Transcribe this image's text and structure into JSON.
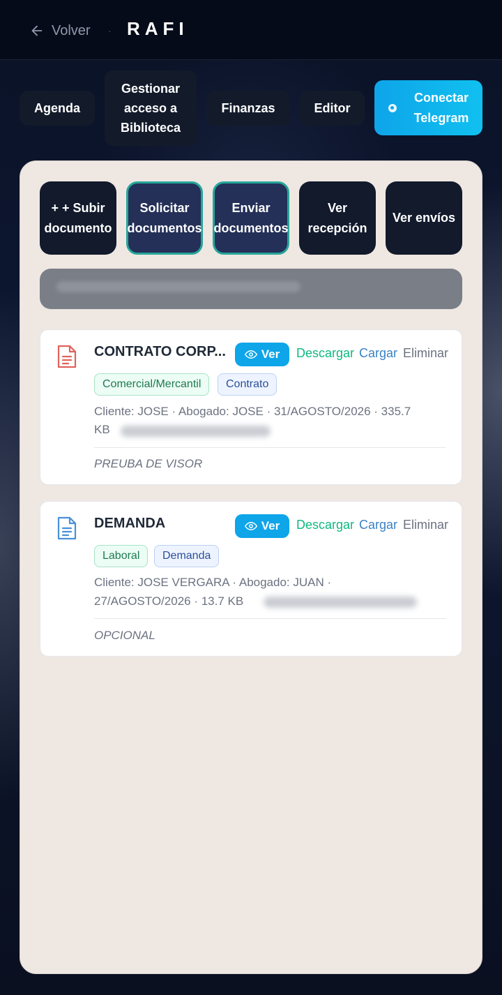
{
  "header": {
    "back_label": "Volver",
    "separator": "·",
    "brand": "RAFI"
  },
  "nav": {
    "agenda": "Agenda",
    "biblioteca": "Gestionar acceso a Biblioteca",
    "finanzas": "Finanzas",
    "editor": "Editor",
    "telegram": "Conectar Telegram"
  },
  "actions": {
    "subir": "+ + Subir documento",
    "solicitar": "Solicitar documentos",
    "enviar": "Enviar documentos",
    "recepcion": "Ver recepción",
    "envios": "Ver envíos"
  },
  "documents": [
    {
      "title": "CONTRATO CORP...",
      "icon_color": "#e0625c",
      "view": "Ver",
      "download": "Descargar",
      "upload": "Cargar",
      "delete": "Eliminar",
      "tags": [
        "Comercial/Mercantil",
        "Contrato"
      ],
      "meta_line1": "Cliente: JOSE   · Abogado: JOSE   · 31/AGOSTO/2026   · 335.7",
      "meta_line2": "KB",
      "note": "PREUBA DE VISOR"
    },
    {
      "title": "DEMANDA",
      "icon_color": "#4a90d9",
      "view": "Ver",
      "download": "Descargar",
      "upload": "Cargar",
      "delete": "Eliminar",
      "tags": [
        "Laboral",
        "Demanda"
      ],
      "meta_line1": "Cliente: JOSE VERGARA   · Abogado: JUAN   ·",
      "meta_line2": "27/AGOSTO/2026   · 13.7 KB",
      "note": "OPCIONAL"
    }
  ]
}
